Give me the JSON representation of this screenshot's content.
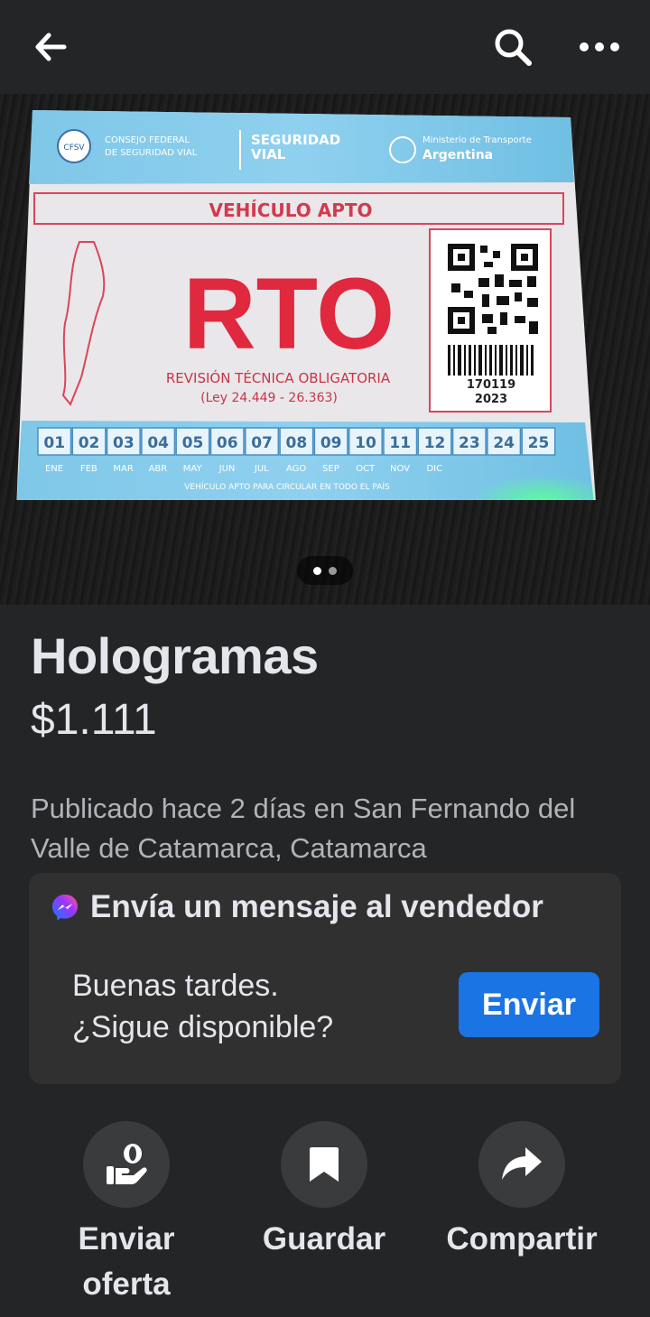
{
  "listing": {
    "title": "Hologramas",
    "price": "$1.111",
    "posted": "Publicado hace 2 días en San Fernando del Valle de Catamarca, Catamarca"
  },
  "photo": {
    "page_index": 1,
    "page_count": 2,
    "sticker": {
      "org_line1": "CONSEJO FEDERAL",
      "org_line2": "DE SEGURIDAD VIAL",
      "org_badge": "CFSV",
      "seguridad_line1": "SEGURIDAD",
      "seguridad_line2": "VIAL",
      "ministry": "Ministerio de Transporte",
      "country": "Argentina",
      "status": "VEHÍCULO APTO",
      "rto": "RTO",
      "rto_full": "REVISIÓN TÉCNICA OBLIGATORIA",
      "law": "(Ley 24.449 - 26.363)",
      "serial": "170119",
      "year": "2023",
      "numbers": [
        "01",
        "02",
        "03",
        "04",
        "05",
        "06",
        "07",
        "08",
        "09",
        "10",
        "11",
        "12",
        "23",
        "24",
        "25"
      ],
      "months": [
        "ENE",
        "FEB",
        "MAR",
        "ABR",
        "MAY",
        "JUN",
        "JUL",
        "AGO",
        "SEP",
        "OCT",
        "NOV",
        "DIC"
      ],
      "footer": "VEHÍCULO APTO PARA CIRCULAR EN TODO EL PAÍS"
    }
  },
  "message": {
    "heading": "Envía un mensaje al vendedor",
    "line1": "Buenas tardes.",
    "line2": "¿Sigue disponible?",
    "send_label": "Enviar"
  },
  "actions": {
    "offer_line1": "Enviar",
    "offer_line2": "oferta",
    "save": "Guardar",
    "share": "Compartir"
  },
  "colors": {
    "background": "#242526",
    "card": "#303031",
    "accent": "#1b74e4",
    "text": "#e4e6eb",
    "secondary_text": "#b0b3b8"
  },
  "icons": [
    "back-arrow-icon",
    "search-icon",
    "more-icon",
    "messenger-icon",
    "offer-hand-icon",
    "bookmark-icon",
    "share-arrow-icon"
  ]
}
